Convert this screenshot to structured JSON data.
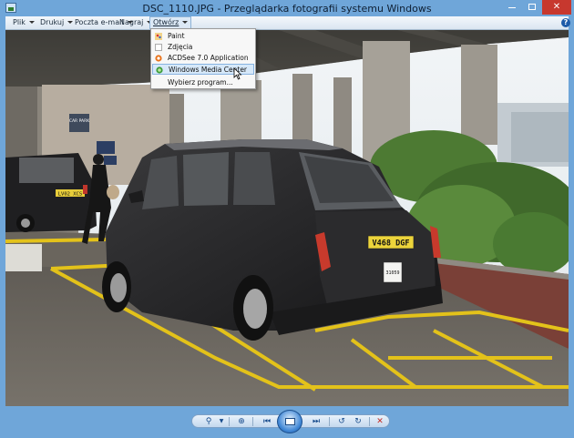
{
  "window": {
    "title": "DSC_1110.JPG - Przeglądarka fotografii systemu Windows",
    "accent_color": "#6fa6d9",
    "close_color": "#c7382e"
  },
  "menubar": {
    "items": [
      {
        "label": "Plik"
      },
      {
        "label": "Drukuj"
      },
      {
        "label": "Poczta e-mail"
      },
      {
        "label": "Nagraj"
      },
      {
        "label": "Otwórz"
      }
    ],
    "help_label": "?"
  },
  "open_menu": {
    "items": [
      {
        "label": "Paint",
        "icon": "paint-icon"
      },
      {
        "label": "Zdjęcia",
        "icon": "photos-icon"
      },
      {
        "label": "ACDSee 7.0 Application",
        "icon": "acdsee-icon"
      },
      {
        "label": "Windows Media Center",
        "icon": "media-center-icon",
        "highlighted": true
      },
      {
        "label": "Wybierz program...",
        "icon": ""
      }
    ]
  },
  "photo": {
    "plate_front": "V468 DGF",
    "plate_rear_left": "LV02 XCS",
    "taxi_number": "31059",
    "sign_text": "CAR PARK"
  },
  "toolbar": {
    "buttons": [
      "zoom-icon",
      "fit-icon",
      "previous-icon",
      "slideshow-icon",
      "next-icon",
      "rotate-left-icon",
      "rotate-right-icon",
      "delete-icon"
    ]
  }
}
